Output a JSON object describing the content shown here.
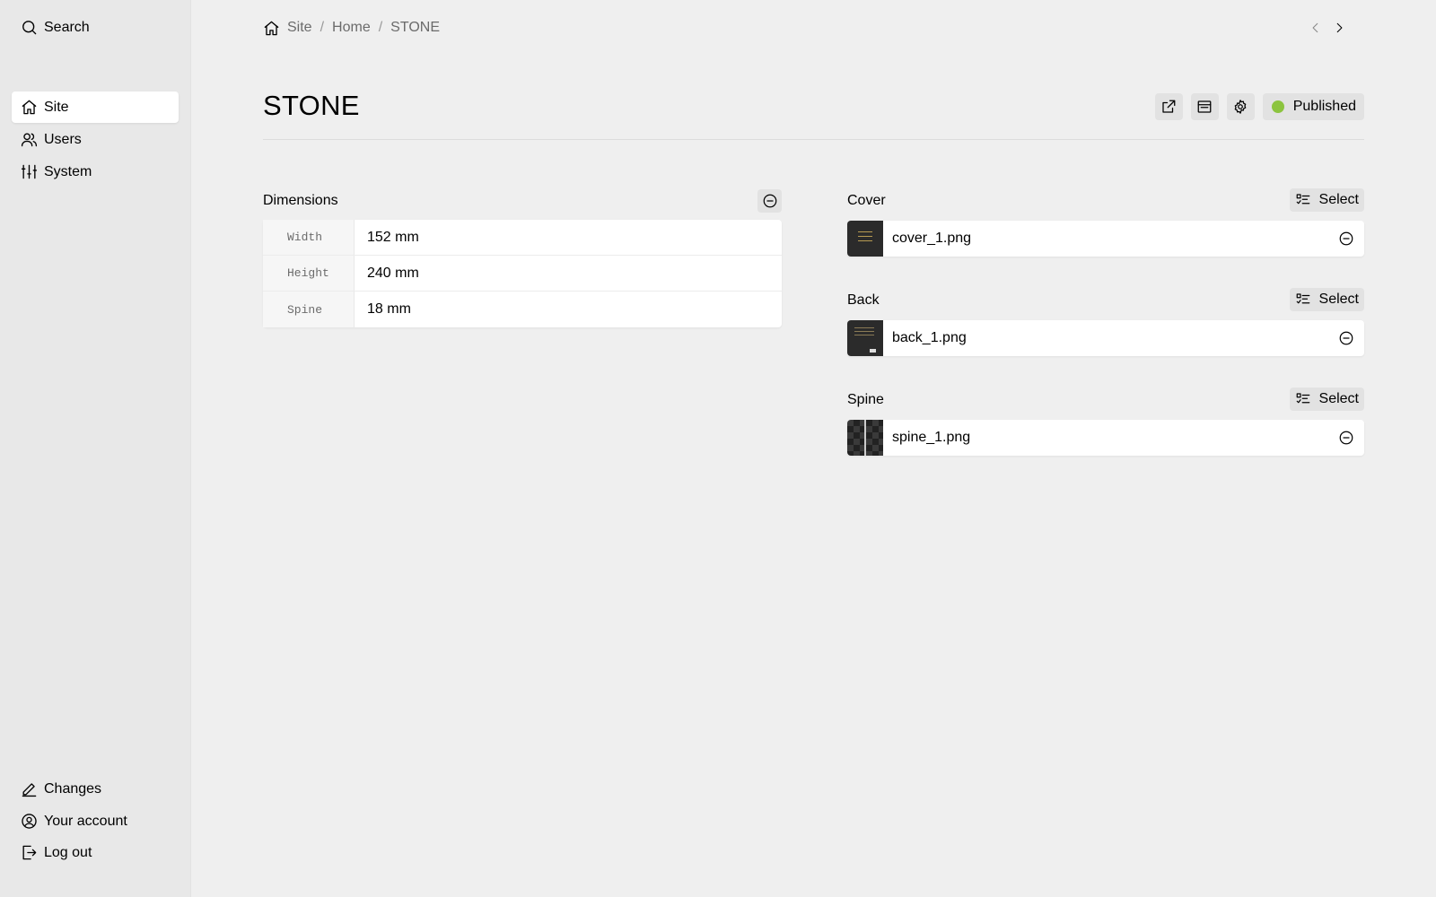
{
  "sidebar": {
    "search_label": "Search",
    "nav": [
      {
        "label": "Site",
        "icon": "home-icon",
        "active": true
      },
      {
        "label": "Users",
        "icon": "users-icon",
        "active": false
      },
      {
        "label": "System",
        "icon": "sliders-icon",
        "active": false
      }
    ],
    "footer": [
      {
        "label": "Changes",
        "icon": "pencil-icon"
      },
      {
        "label": "Your account",
        "icon": "user-circle-icon"
      },
      {
        "label": "Log out",
        "icon": "logout-icon"
      }
    ]
  },
  "breadcrumb": [
    "Site",
    "Home",
    "STONE"
  ],
  "breadcrumb_separator": "/",
  "page": {
    "title": "STONE",
    "status_label": "Published",
    "status_color": "#8cc43f"
  },
  "dimensions": {
    "label": "Dimensions",
    "rows": [
      {
        "key": "Width",
        "value": "152 mm"
      },
      {
        "key": "Height",
        "value": "240 mm"
      },
      {
        "key": "Spine",
        "value": "18 mm"
      }
    ]
  },
  "files": [
    {
      "label": "Cover",
      "select_label": "Select",
      "filename": "cover_1.png"
    },
    {
      "label": "Back",
      "select_label": "Select",
      "filename": "back_1.png"
    },
    {
      "label": "Spine",
      "select_label": "Select",
      "filename": "spine_1.png"
    }
  ]
}
